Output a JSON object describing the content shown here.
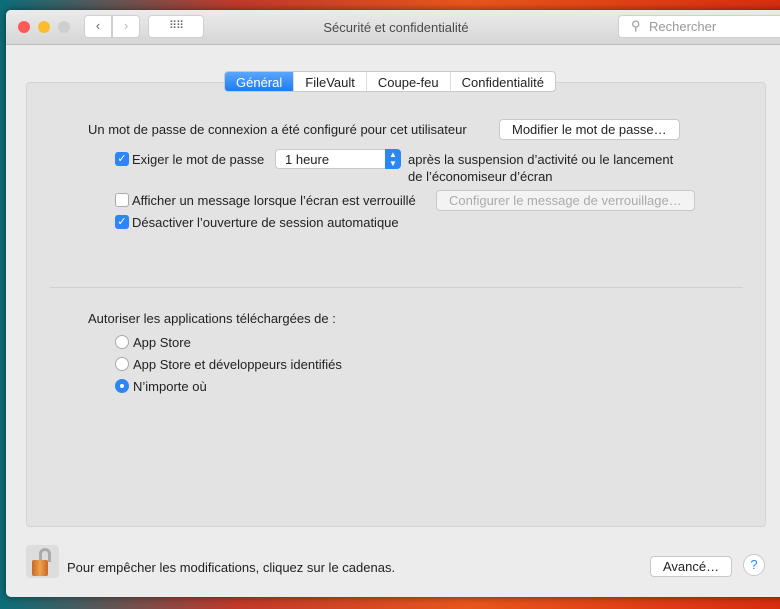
{
  "window": {
    "title": "Sécurité et confidentialité",
    "search_placeholder": "Rechercher"
  },
  "tabs": [
    {
      "label": "Général",
      "active": true
    },
    {
      "label": "FileVault"
    },
    {
      "label": "Coupe-feu"
    },
    {
      "label": "Confidentialité"
    }
  ],
  "general": {
    "password_text": "Un mot de passe de connexion a été configuré pour cet utilisateur",
    "change_password_button": "Modifier le mot de passe…",
    "require_password": {
      "label": "Exiger le mot de passe",
      "checked": true,
      "select_value": "1 heure",
      "after_line1": "après la suspension d’activité ou le lancement",
      "after_line2": "de l’économiseur d’écran"
    },
    "show_message": {
      "label": "Afficher un message lorsque l’écran est verrouillé",
      "checked": false,
      "button": "Configurer le message de verrouillage…"
    },
    "disable_auto_login": {
      "label": "Désactiver l’ouverture de session automatique",
      "checked": true
    },
    "allow_apps_label": "Autoriser les applications téléchargées de :",
    "allow_options": [
      {
        "label": "App Store",
        "selected": false
      },
      {
        "label": "App Store et développeurs identifiés",
        "selected": false
      },
      {
        "label": "N’importe où",
        "selected": true
      }
    ]
  },
  "footer": {
    "lock_text": "Pour empêcher les modifications, cliquez sur le cadenas.",
    "advanced_button": "Avancé…",
    "help": "?"
  },
  "colors": {
    "accent": "#2d86f5"
  }
}
